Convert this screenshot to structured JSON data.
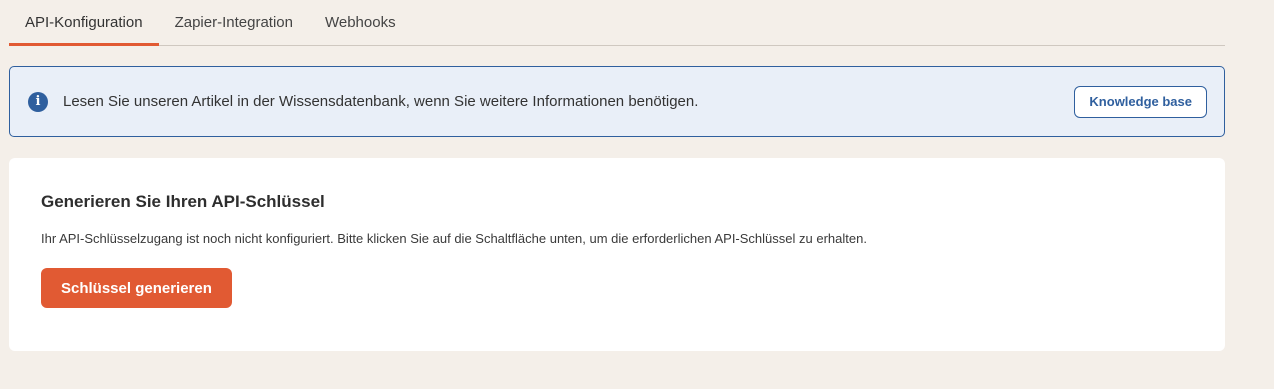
{
  "tabs": [
    {
      "label": "API-Konfiguration",
      "active": true
    },
    {
      "label": "Zapier-Integration",
      "active": false
    },
    {
      "label": "Webhooks",
      "active": false
    }
  ],
  "info_banner": {
    "icon": "info-icon",
    "text": "Lesen Sie unseren Artikel in der Wissensdatenbank, wenn Sie weitere Informationen benötigen.",
    "button_label": "Knowledge base"
  },
  "card": {
    "title": "Generieren Sie Ihren API-Schlüssel",
    "description": "Ihr API-Schlüsselzugang ist noch nicht konfiguriert. Bitte klicken Sie auf die Schaltfläche unten, um die erforderlichen API-Schlüssel zu erhalten.",
    "button_label": "Schlüssel generieren"
  },
  "colors": {
    "accent": "#e15a33",
    "info_blue": "#2f5f9e",
    "info_bg": "#e9eff8",
    "page_bg": "#f4efe9"
  }
}
